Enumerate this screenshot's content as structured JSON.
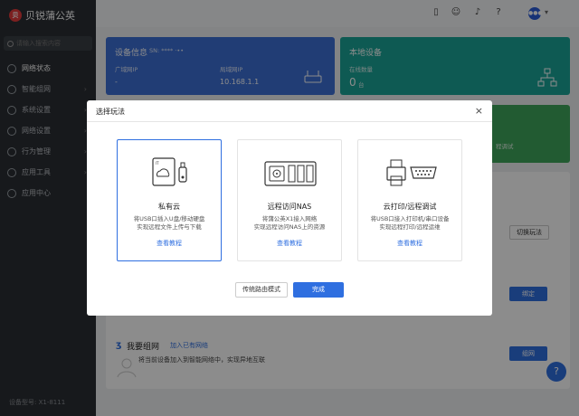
{
  "brand": {
    "name": "贝锐蒲公英"
  },
  "sidebar": {
    "search_placeholder": "请输入搜索内容",
    "items": [
      {
        "label": "网络状态"
      },
      {
        "label": "智能组网"
      },
      {
        "label": "系统设置"
      },
      {
        "label": "网络设置"
      },
      {
        "label": "行为管理"
      },
      {
        "label": "应用工具"
      },
      {
        "label": "应用中心"
      }
    ],
    "device_model": "设备型号: X1-8111"
  },
  "topbar": {
    "avatar_text": "●●●"
  },
  "cards": {
    "device_info": {
      "title": "设备信息",
      "sn": "SN: **** ·••",
      "wan_label": "广域网IP",
      "wan_value": "-",
      "lan_label": "局域网IP",
      "lan_value": "10.168.1.1"
    },
    "local_devices": {
      "title": "本地设备",
      "count_label": "在线数量",
      "count_value": "0",
      "count_unit": "台"
    },
    "remote": {
      "partial_text": "程调试"
    }
  },
  "background": {
    "switch_button": "切换玩法",
    "bind_button": "绑定",
    "join_title": "我要组网",
    "join_link": "加入已有网络",
    "join_desc": "将当前设备加入到智能网络中，实现异地互联",
    "network_button": "组网",
    "help": "?"
  },
  "modal": {
    "title": "选择玩法",
    "close": "×",
    "options": [
      {
        "title": "私有云",
        "desc1": "将USB口插入U盘/移动硬盘",
        "desc2": "实现远程文件上传与下载",
        "link": "查看教程"
      },
      {
        "title": "远程访问NAS",
        "desc1": "将蒲公英X1接入网络",
        "desc2": "实现远程访问NAS上的资源",
        "link": "查看教程"
      },
      {
        "title": "云打印/远程调试",
        "desc1": "将USB口接入打印机/串口设备",
        "desc2": "实现远程打印/远程运维",
        "link": "查看教程"
      }
    ],
    "traditional_button": "传统路由模式",
    "done_button": "完成"
  },
  "colors": {
    "accent": "#2f6fe0",
    "sidebar": "#2b2e33",
    "card_blue": "#3c6fd6",
    "card_teal": "#1aa597",
    "card_green": "#3ea65b"
  }
}
